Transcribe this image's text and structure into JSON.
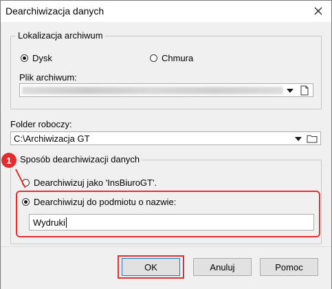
{
  "window": {
    "title": "Dearchiwizacja danych"
  },
  "archive_location": {
    "legend": "Lokalizacja archiwum",
    "options": [
      {
        "label": "Dysk",
        "selected": true
      },
      {
        "label": "Chmura",
        "selected": false
      }
    ],
    "file_label": "Plik archiwum:"
  },
  "working_folder": {
    "label": "Folder roboczy:",
    "value": "C:\\Archiwizacja GT"
  },
  "method": {
    "legend": "Sposób dearchiwizacji danych",
    "options": [
      {
        "label": "Dearchiwizuj jako 'InsBiuroGT'.",
        "selected": false
      },
      {
        "label": "Dearchiwizuj do podmiotu o nazwie:",
        "selected": true
      }
    ],
    "entity_name": "Wydruki"
  },
  "annotation": {
    "marker_number": "1",
    "color": "#e12d2d"
  },
  "buttons": {
    "ok": "OK",
    "cancel": "Anuluj",
    "help": "Pomoc"
  },
  "icons": {
    "close": "close-icon",
    "file": "document-icon",
    "folder": "folder-icon",
    "dropdown": "chevron-down-icon"
  }
}
